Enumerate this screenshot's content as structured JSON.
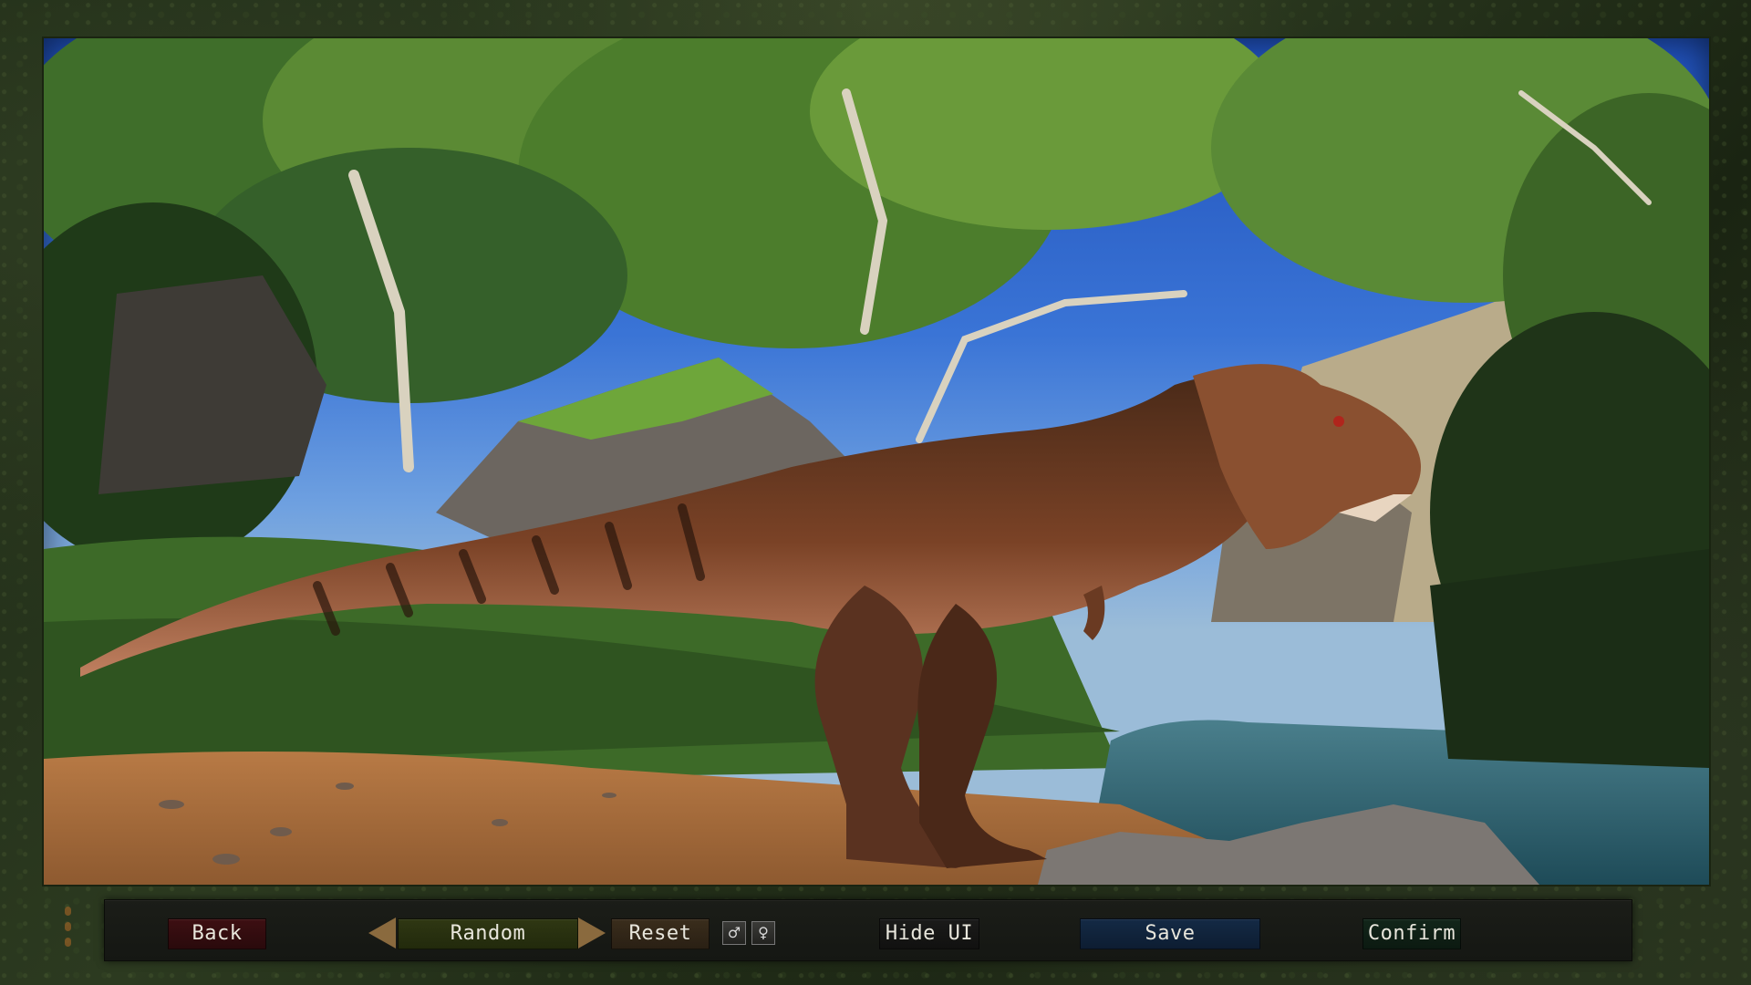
{
  "scene": {
    "subject": "Tyrannosaurus",
    "environment": "jungle riverbank"
  },
  "toolbar": {
    "back_label": "Back",
    "random_label": "Random",
    "reset_label": "Reset",
    "male_symbol": "♂",
    "female_symbol": "♀",
    "hide_ui_label": "Hide UI",
    "save_label": "Save",
    "confirm_label": "Confirm"
  },
  "colors": {
    "back": "#3d0f12",
    "random": "#2f3713",
    "reset": "#3a2d1c",
    "save": "#142a45",
    "confirm": "#12261a",
    "arrow": "#8a6a3e"
  }
}
